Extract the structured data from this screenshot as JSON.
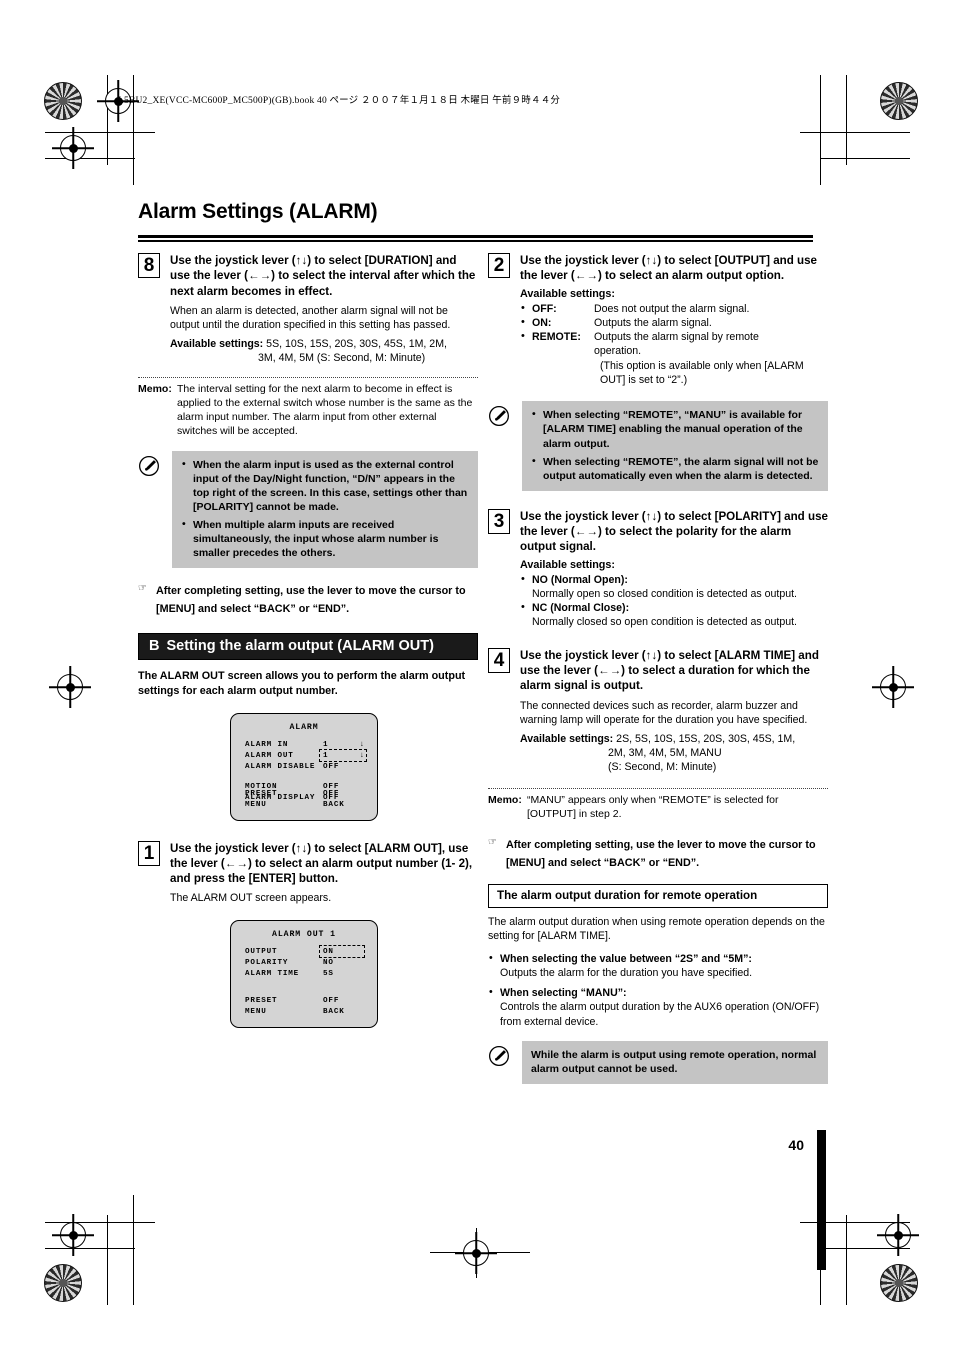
{
  "print": {
    "book_line": "L5BU2_XE(VCC-MC600P_MC500P)(GB).book   40 ページ   ２００７年１月１８日   木曜日   午前９時４４分"
  },
  "page": {
    "title": "Alarm Settings (ALARM)",
    "number": "40"
  },
  "left_column": {
    "step8": {
      "number": "8",
      "lead": "Use the joystick lever (↑↓) to select [DURATION] and use the lever (←→) to select the interval after which the next alarm becomes in effect.",
      "desc": "When an alarm is detected, another alarm signal will not be output until the duration specified in this setting has passed.",
      "available_label": "Available settings:",
      "available_line1": "5S, 10S, 15S, 20S, 30S, 45S, 1M, 2M,",
      "available_line2": "3M, 4M, 5M (S: Second, M: Minute)"
    },
    "memo": {
      "label": "Memo:",
      "text": "The interval setting for the next alarm to become in effect is applied to the external switch whose number is the same as the alarm input number. The alarm input from other external switches will be accepted."
    },
    "note": {
      "icon": "pencil-icon",
      "bullets": [
        "When the alarm input is used as the external control input of the Day/Night function, “D/N” appears in the top right of the screen. In this case, settings other than [POLARITY] cannot be made.",
        "When multiple alarm inputs are received simultaneously, the input whose alarm number is smaller precedes the others."
      ]
    },
    "after_note": {
      "icon": "hand-pointer-icon",
      "text": "After completing setting, use the lever to move the cursor to [MENU] and select “BACK” or “END”."
    },
    "section": {
      "letter": "B",
      "title": "Setting the alarm output (ALARM OUT)",
      "intro": "The ALARM OUT screen allows you to perform the alarm output settings for each alarm output number."
    },
    "osd_alarm": {
      "title": "ALARM",
      "rows": [
        {
          "key": "ALARM IN",
          "value": "1",
          "arrow": "↓"
        },
        {
          "key": "ALARM OUT",
          "value": "1",
          "arrow": "↓"
        },
        {
          "key": "ALARM DISABLE",
          "value": "OFF",
          "arrow": ""
        },
        {
          "key": "MOTION",
          "value": "OFF",
          "arrow": ""
        },
        {
          "key": "ALARM DISPLAY",
          "value": "OFF",
          "arrow": ""
        }
      ],
      "footer": [
        {
          "key": "PRESET",
          "value": "OFF"
        },
        {
          "key": "MENU",
          "value": "BACK"
        }
      ]
    },
    "step1": {
      "number": "1",
      "lead": "Use the joystick lever (↑↓) to select [ALARM OUT], use the lever (←→) to select an alarm output number (1- 2), and press the [ENTER] button.",
      "desc": "The ALARM OUT screen appears."
    },
    "osd_alarm_out": {
      "title": "ALARM OUT 1",
      "rows": [
        {
          "key": "OUTPUT",
          "value": "ON",
          "arrow": ""
        },
        {
          "key": "POLARITY",
          "value": "NO",
          "arrow": ""
        },
        {
          "key": "ALARM TIME",
          "value": "5S",
          "arrow": ""
        }
      ],
      "footer": [
        {
          "key": "PRESET",
          "value": "OFF"
        },
        {
          "key": "MENU",
          "value": "BACK"
        }
      ]
    }
  },
  "right_column": {
    "step2": {
      "number": "2",
      "lead": "Use the joystick lever (↑↓) to select [OUTPUT] and use the lever (←→) to select an alarm output option.",
      "available_label": "Available settings:",
      "options": [
        {
          "term": "OFF:",
          "defn": "Does not output the alarm signal.",
          "sub": ""
        },
        {
          "term": "ON:",
          "defn": "Outputs the alarm signal.",
          "sub": ""
        },
        {
          "term": "REMOTE:",
          "defn": "Outputs the alarm signal by remote operation.",
          "sub": "(This option is available only when [ALARM OUT] is set to “2”.)"
        }
      ]
    },
    "note": {
      "icon": "pencil-icon",
      "bullets": [
        "When selecting “REMOTE”, “MANU” is available for [ALARM TIME] enabling the manual operation of the alarm output.",
        "When selecting “REMOTE”, the alarm signal will not be output automatically even when the alarm is detected."
      ]
    },
    "step3": {
      "number": "3",
      "lead": "Use the joystick lever (↑↓) to select [POLARITY] and use the lever (←→) to select the polarity for the alarm output signal.",
      "available_label": "Available settings:",
      "options": [
        {
          "term": "NO (Normal Open):",
          "defn": "Normally open so closed condition is detected as output."
        },
        {
          "term": "NC (Normal Close):",
          "defn": "Normally closed so open condition is detected as output."
        }
      ]
    },
    "step4": {
      "number": "4",
      "lead": "Use the joystick lever (↑↓) to select [ALARM TIME] and use the lever (←→) to select a duration for which the alarm signal is output.",
      "desc": "The connected devices such as recorder, alarm buzzer and warning lamp will operate for the duration you have specified.",
      "available_label": "Available settings:",
      "available_line1": "2S, 5S, 10S, 15S, 20S, 30S, 45S, 1M,",
      "available_line2": "2M, 3M, 4M, 5M, MANU",
      "available_line3": "(S: Second, M: Minute)"
    },
    "memo": {
      "label": "Memo:",
      "text": "“MANU” appears only when “REMOTE” is selected for [OUTPUT] in step 2."
    },
    "after_note": {
      "icon": "hand-pointer-icon",
      "text": "After completing setting, use the lever to move the cursor to [MENU] and select “BACK” or “END”."
    },
    "duration_section": {
      "heading": "The alarm output duration for remote operation",
      "intro": "The alarm output duration when using remote operation depends on the setting for [ALARM TIME].",
      "bullets": [
        {
          "head": "When selecting the value between “2S” and “5M”:",
          "text": "Outputs the alarm for the duration you have specified."
        },
        {
          "head": "When selecting “MANU”:",
          "text": "Controls the alarm output duration by the AUX6 operation (ON/OFF) from external device."
        }
      ],
      "note": {
        "icon": "pencil-icon",
        "text": "While the alarm is output using remote operation, normal alarm output cannot be used."
      }
    }
  }
}
